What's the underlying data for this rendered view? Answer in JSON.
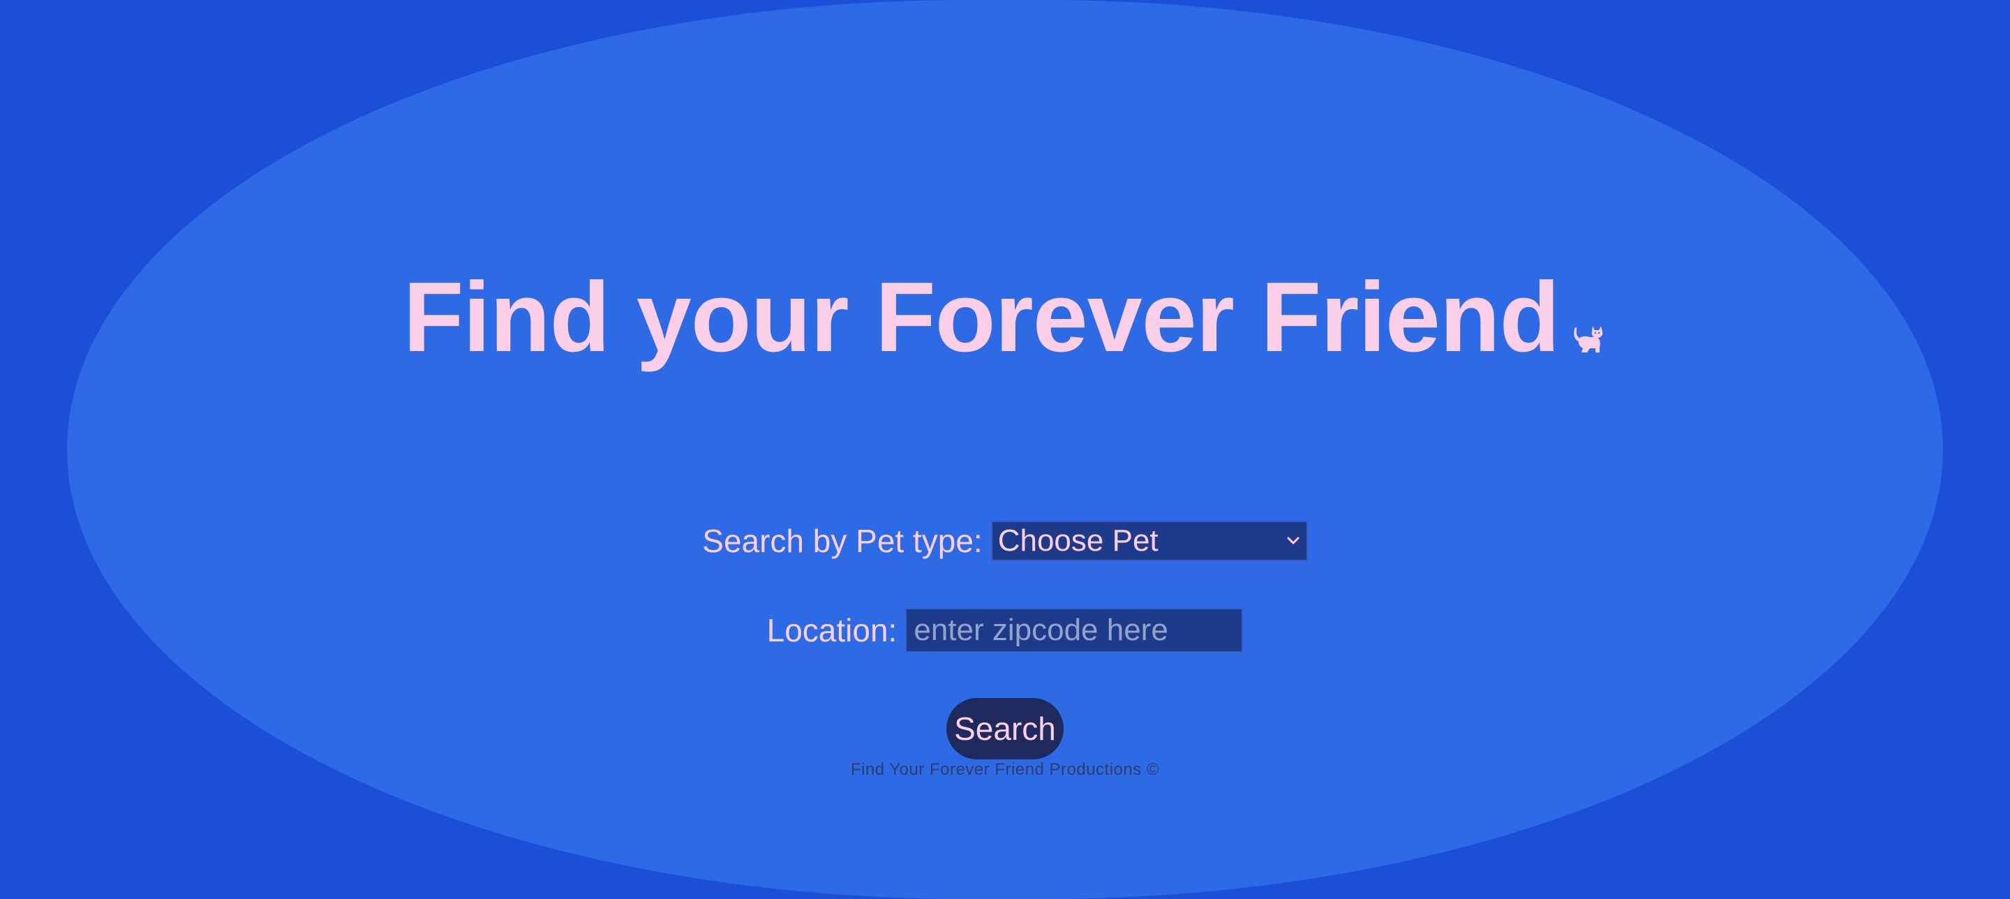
{
  "header": {
    "title": "Find your Forever Friend",
    "title_icon": "cat-icon"
  },
  "search_form": {
    "pet_type_label": "Search by Pet type:",
    "pet_type_selected": "Choose Pet",
    "location_label": "Location:",
    "location_placeholder": "enter zipcode here",
    "location_value": "",
    "search_button_label": "Search"
  },
  "footer": {
    "text": "Find Your Forever Friend Productions ©"
  },
  "colors": {
    "background": "#1d4ed8",
    "oval": "#2d6ae6",
    "accent_text": "#fbcfe8",
    "field_bg": "#1e3a8a",
    "button_bg": "#1e2a5e"
  }
}
